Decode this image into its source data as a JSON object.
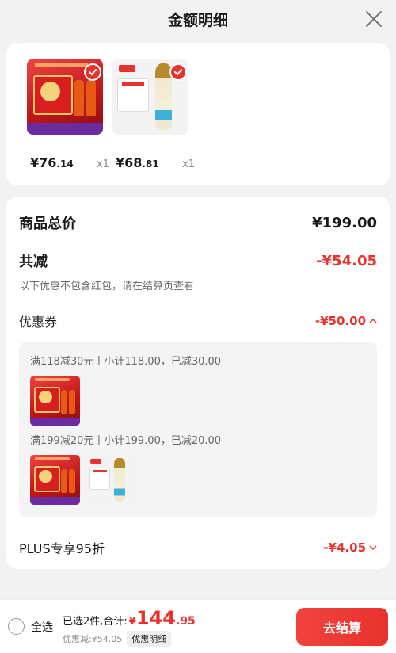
{
  "header": {
    "title": "金额明细"
  },
  "products": [
    {
      "price_int": "¥76",
      "price_dec": ".14",
      "qty": "x1"
    },
    {
      "price_int": "¥68",
      "price_dec": ".81",
      "qty": "x1"
    }
  ],
  "summary": {
    "total_label": "商品总价",
    "total_value": "¥199.00",
    "reduce_label": "共减",
    "reduce_value": "-¥54.05",
    "note": "以下优惠不包含红包，请在结算页查看",
    "coupon_label": "优惠券",
    "coupon_value": "-¥50.00",
    "rules": [
      "满118减30元丨小计118.00，已减30.00",
      "满199减20元丨小计199.00，已减20.00"
    ],
    "plus_label": "PLUS专享95折",
    "plus_value": "-¥4.05"
  },
  "bottom": {
    "select_all": "全选",
    "selected": "已选2件,合计:",
    "currency": "¥",
    "total_int": "144",
    "total_dec": ".95",
    "discount": "优惠减:¥54.05",
    "detail_btn": "优惠明细",
    "checkout": "去结算"
  },
  "colors": {
    "accent": "#e8322e",
    "background": "#f2f2f2"
  },
  "icons": [
    "close-icon",
    "check-icon",
    "chevron-up-icon",
    "chevron-down-icon"
  ]
}
